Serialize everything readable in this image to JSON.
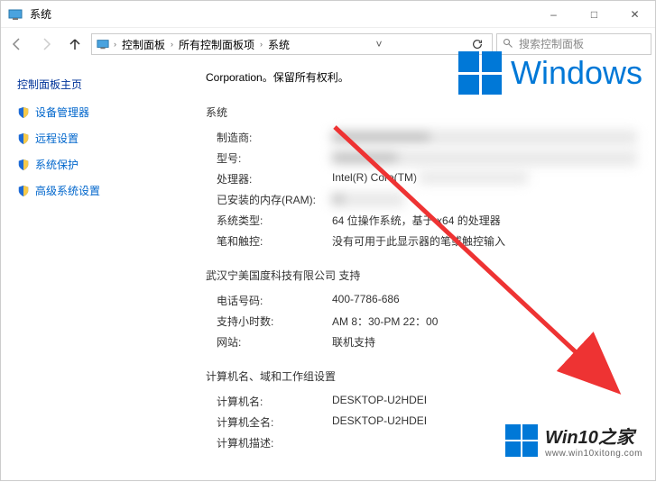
{
  "window": {
    "title": "系统",
    "minimize": "–",
    "maximize": "□",
    "close": "✕"
  },
  "breadcrumb": {
    "root_chev": "›",
    "items": [
      "控制面板",
      "所有控制面板项",
      "系统"
    ]
  },
  "search": {
    "placeholder": "搜索控制面板"
  },
  "sidebar": {
    "heading": "控制面板主页",
    "items": [
      "设备管理器",
      "远程设置",
      "系统保护",
      "高级系统设置"
    ]
  },
  "corp_text": "Corporation。保留所有权利。",
  "windows_text": "Windows",
  "sections": {
    "system": {
      "title": "系统",
      "rows": [
        {
          "label": "制造商:",
          "value": ""
        },
        {
          "label": "型号:",
          "value": ""
        },
        {
          "label": "处理器:",
          "value": "Intel(R) Core(TM)"
        },
        {
          "label": "已安装的内存(RAM):",
          "value": ""
        },
        {
          "label": "系统类型:",
          "value": "64 位操作系统，基于 x64 的处理器"
        },
        {
          "label": "笔和触控:",
          "value": "没有可用于此显示器的笔或触控输入"
        }
      ]
    },
    "support": {
      "title": "武汉宁美国度科技有限公司 支持",
      "rows": [
        {
          "label": "电话号码:",
          "value": "400-7786-686"
        },
        {
          "label": "支持小时数:",
          "value": "AM 8：30-PM 22：00"
        },
        {
          "label": "网站:",
          "value": "联机支持"
        }
      ]
    },
    "computer": {
      "title": "计算机名、域和工作组设置",
      "rows": [
        {
          "label": "计算机名:",
          "value": "DESKTOP-U2HDEI"
        },
        {
          "label": "计算机全名:",
          "value": "DESKTOP-U2HDEI"
        },
        {
          "label": "计算机描述:",
          "value": ""
        }
      ]
    }
  },
  "watermark": {
    "main": "Win10之家",
    "sub": "www.win10xitong.com"
  }
}
